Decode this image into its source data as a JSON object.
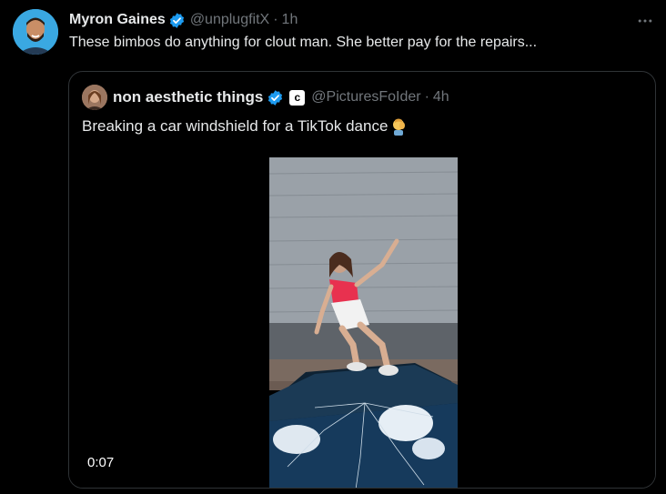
{
  "tweet": {
    "display_name": "Myron Gaines",
    "handle": "@unplugfitX",
    "separator": "·",
    "time": "1h",
    "text": "These bimbos do anything for clout man. She better pay for the repairs...",
    "more_icon": "more-horizontal-icon",
    "verified_icon": "verified-badge-icon"
  },
  "quote": {
    "display_name": "non aesthetic things",
    "handle": "@PicturesFoIder",
    "separator": "·",
    "time": "4h",
    "text": "Breaking a car windshield for a TikTok dance",
    "emoji": "facepalm-emoji",
    "badge_letter": "c",
    "video": {
      "duration": "0:07"
    }
  },
  "colors": {
    "background": "#000000",
    "text_primary": "#e7e9ea",
    "text_secondary": "#71767b",
    "border": "#2f3336",
    "verified_blue": "#1d9bf0"
  }
}
